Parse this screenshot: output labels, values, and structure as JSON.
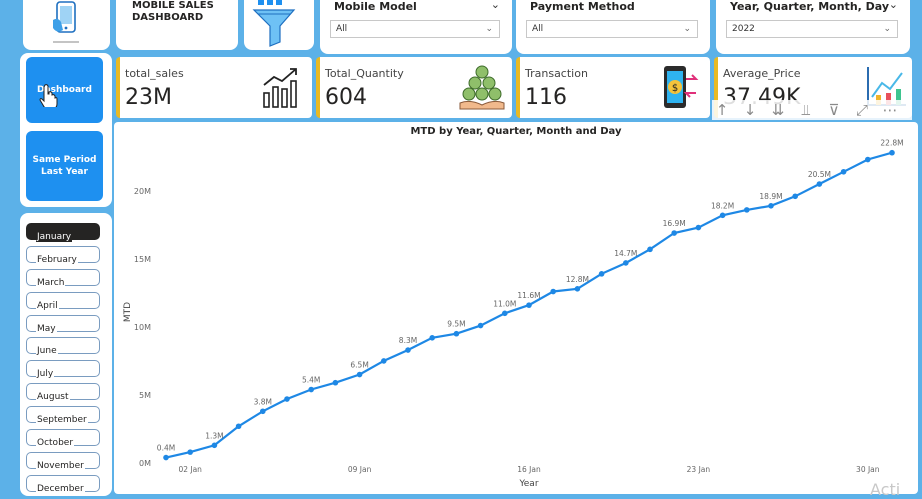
{
  "header": {
    "title": "MOBILE SALES\nDASHBOARD"
  },
  "slicers": [
    {
      "label": "Mobile Model",
      "value": "All"
    },
    {
      "label": "Payment Method",
      "value": "All"
    },
    {
      "label": "Year, Quarter, Month, Day",
      "value": "2022"
    }
  ],
  "nav": {
    "dashboard": "Dashboard",
    "same_period": "Same Period\nLast Year"
  },
  "kpis": [
    {
      "label": "total_sales",
      "value": "23M",
      "icon": "bar-chart-up-icon"
    },
    {
      "label": "Total_Quantity",
      "value": "604",
      "icon": "coins-hand-icon"
    },
    {
      "label": "Transaction",
      "value": "116",
      "icon": "phone-payment-icon"
    },
    {
      "label": "Average_Price",
      "value": "37.49K",
      "icon": "trend-chart-icon"
    }
  ],
  "months": [
    "January",
    "February",
    "March",
    "April",
    "May",
    "June",
    "July",
    "August",
    "September",
    "October",
    "November",
    "December"
  ],
  "active_month": "January",
  "toolbar_icons": [
    "sort-up-icon",
    "sort-down-icon",
    "drill-down-icon",
    "expand-hierarchy-icon",
    "filter-icon",
    "focus-mode-icon",
    "more-options-icon"
  ],
  "watermark": "Acti",
  "colors": {
    "accent": "#1e90f0",
    "background": "#5cb1e8",
    "kpi_bar": "#e8b923",
    "line": "#1e88e5"
  },
  "chart_data": {
    "type": "line",
    "title": "MTD by Year, Quarter, Month and Day",
    "xlabel": "Year",
    "ylabel": "MTD",
    "x_ticks": [
      "02 Jan",
      "09 Jan",
      "16 Jan",
      "23 Jan",
      "30 Jan"
    ],
    "y_ticks": [
      "0M",
      "5M",
      "10M",
      "15M",
      "20M"
    ],
    "ylim": [
      0,
      23
    ],
    "grid": false,
    "series": [
      {
        "x": [
          "01 Jan",
          "02 Jan",
          "03 Jan",
          "04 Jan",
          "05 Jan",
          "06 Jan",
          "07 Jan",
          "08 Jan",
          "09 Jan",
          "10 Jan",
          "11 Jan",
          "12 Jan",
          "13 Jan",
          "14 Jan",
          "15 Jan",
          "16 Jan",
          "17 Jan",
          "18 Jan",
          "19 Jan",
          "20 Jan",
          "21 Jan",
          "22 Jan",
          "23 Jan",
          "24 Jan",
          "25 Jan",
          "26 Jan",
          "27 Jan",
          "28 Jan",
          "29 Jan",
          "30 Jan",
          "31 Jan"
        ],
        "values": [
          0.4,
          0.8,
          1.3,
          2.7,
          3.8,
          4.7,
          5.4,
          5.9,
          6.5,
          7.5,
          8.3,
          9.2,
          9.5,
          10.1,
          11.0,
          11.6,
          12.6,
          12.8,
          13.9,
          14.7,
          15.7,
          16.9,
          17.3,
          18.2,
          18.6,
          18.9,
          19.6,
          20.5,
          21.4,
          22.3,
          22.8
        ],
        "labels": [
          "0.4M",
          "",
          "1.3M",
          "",
          "3.8M",
          "",
          "5.4M",
          "",
          "6.5M",
          "",
          "8.3M",
          "",
          "9.5M",
          "",
          "11.0M",
          "11.6M",
          "",
          "12.8M",
          "",
          "14.7M",
          "",
          "16.9M",
          "",
          "18.2M",
          "",
          "18.9M",
          "",
          "20.5M",
          "",
          "",
          "22.8M"
        ]
      }
    ]
  }
}
